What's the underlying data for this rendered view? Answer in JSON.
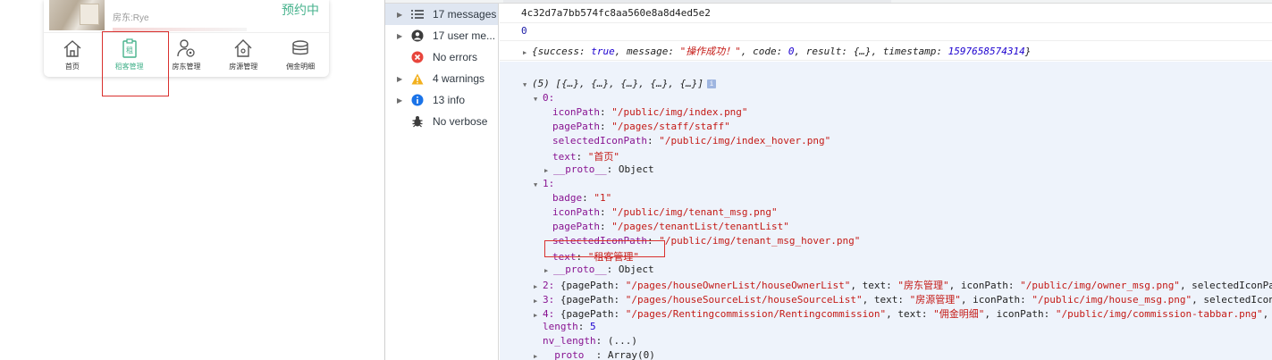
{
  "phone": {
    "landlord_text": "房东:Rye",
    "status_text": "预约中",
    "tabs": [
      {
        "label": "首页",
        "icon": "home-icon",
        "active": false
      },
      {
        "label": "租客管理",
        "icon": "tenant-icon",
        "active": true
      },
      {
        "label": "房东管理",
        "icon": "owner-icon",
        "active": false
      },
      {
        "label": "房源管理",
        "icon": "house-icon",
        "active": false
      },
      {
        "label": "佣金明细",
        "icon": "commission-icon",
        "active": false
      }
    ],
    "accent_color": "#46b28c",
    "highlight_color": "#d9302e"
  },
  "sidebar": {
    "items": [
      {
        "label": "17 messages",
        "icon": "list-icon",
        "expandable": true
      },
      {
        "label": "17 user me...",
        "icon": "user-icon",
        "expandable": true
      },
      {
        "label": "No errors",
        "icon": "error-icon",
        "expandable": false
      },
      {
        "label": "4 warnings",
        "icon": "warning-icon",
        "expandable": true
      },
      {
        "label": "13 info",
        "icon": "info-icon",
        "expandable": true
      },
      {
        "label": "No verbose",
        "icon": "verbose-icon",
        "expandable": false
      }
    ]
  },
  "console": {
    "hash": "4c32d7a7bb574fc8aa560e8a8d4ed5e2",
    "zero": "0",
    "response": {
      "success": "true",
      "message": "\"操作成功！\"",
      "code": "0",
      "result": "{…}",
      "timestamp": "1597658574314"
    },
    "array_summary": "(5) [{…}, {…}, {…}, {…}, {…}]",
    "item0": {
      "index": "0:",
      "iconPath": "\"/public/img/index.png\"",
      "pagePath": "\"/pages/staff/staff\"",
      "selectedIconPath": "\"/public/img/index_hover.png\"",
      "text": "\"首页\"",
      "proto": "Object"
    },
    "item1": {
      "index": "1:",
      "badge": "\"1\"",
      "iconPath": "\"/public/img/tenant_msg.png\"",
      "pagePath": "\"/pages/tenantList/tenantList\"",
      "selectedIconPath": "\"/public/img/tenant_msg_hover.png\"",
      "text": "\"租客管理\"",
      "proto": "Object"
    },
    "item2": {
      "index": "2:",
      "pagePath": "\"/pages/houseOwnerList/houseOwnerList\"",
      "text": "\"房东管理\"",
      "iconPath": "\"/public/img/owner_msg.png\"",
      "tail": ", selectedIconPa"
    },
    "item3": {
      "index": "3:",
      "pagePath": "\"/pages/houseSourceList/houseSourceList\"",
      "text": "\"房源管理\"",
      "iconPath": "\"/public/img/house_msg.png\"",
      "tail": ", selectedIcon"
    },
    "item4": {
      "index": "4:",
      "pagePath": "\"/pages/Rentingcommission/Rentingcommission\"",
      "text": "\"佣金明细\"",
      "iconPath": "\"/public/img/commission-tabbar.png\"",
      "tail": ","
    },
    "length": "5",
    "nv_length": "(...)",
    "array_proto": "Array(0)"
  }
}
